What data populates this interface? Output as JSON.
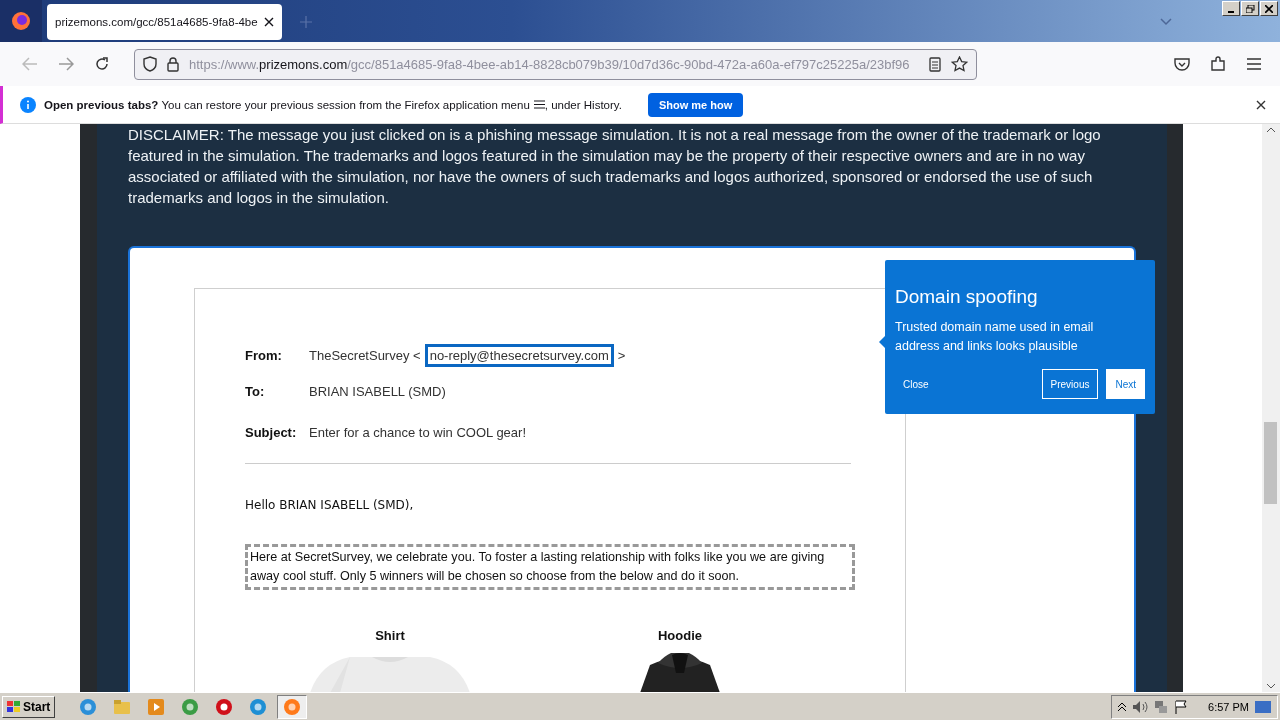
{
  "browser": {
    "tab": {
      "title": "prizemons.com/gcc/851a4685-9fa8-4be",
      "selected": true
    },
    "url": {
      "scheme": "https://www.",
      "host": "prizemons.com",
      "path": "/gcc/851a4685-9fa8-4bee-ab14-8828cb079b39/10d7d36c-90bd-472a-a60a-ef797c25225a/23bf96"
    }
  },
  "notification": {
    "title": "Open previous tabs?",
    "message": "You can restore your previous session from the Firefox application menu",
    "message_end": ", under History.",
    "button": "Show me how"
  },
  "disclaimer": "DISCLAIMER: The message you just clicked on is a phishing message simulation. It is not a real message from the owner of the trademark or logo featured in the simulation. The trademarks and logos featured in the simulation may be the property of their respective owners and are in no way associated or affiliated with the simulation, nor have the owners of such trademarks and logos authorized, sponsored or endorsed the use of such trademarks and logos in the simulation.",
  "email": {
    "from": {
      "label": "From:",
      "name": "TheSecretSurvey",
      "open": "<",
      "address": "no-reply@thesecretsurvey.com",
      "close": ">",
      "highlighted": true
    },
    "to": {
      "label": "To:",
      "value": "BRIAN ISABELL (SMD)"
    },
    "subject": {
      "label": "Subject:",
      "value": "Enter for a chance to win COOL gear!"
    },
    "greeting": "Hello BRIAN ISABELL (SMD),",
    "body": {
      "text": "Here at SecretSurvey, we celebrate you. To foster a lasting relationship with folks like you we are giving away cool stuff.  Only 5 winners will be chosen so choose from the below and do it soon.",
      "highlighted": true
    },
    "products": [
      {
        "name": "Shirt",
        "kind": "light"
      },
      {
        "name": "Hoodie",
        "kind": "dark"
      }
    ]
  },
  "tooltip": {
    "title": "Domain spoofing",
    "text": "Trusted domain name used in email address and links looks plausible",
    "buttons": [
      {
        "label": "Close",
        "kind": "link"
      },
      {
        "label": "Previous",
        "kind": "outline"
      },
      {
        "label": "Next",
        "kind": "solid"
      }
    ]
  },
  "taskbar": {
    "start": "Start",
    "apps": [
      {
        "kind": "ie",
        "selected": false
      },
      {
        "kind": "folder",
        "selected": false
      },
      {
        "kind": "media",
        "selected": false
      },
      {
        "kind": "chrome",
        "selected": false
      },
      {
        "kind": "opera",
        "selected": false
      },
      {
        "kind": "edge",
        "selected": false
      },
      {
        "kind": "firefox",
        "selected": true
      }
    ],
    "time": "6:57 PM"
  }
}
